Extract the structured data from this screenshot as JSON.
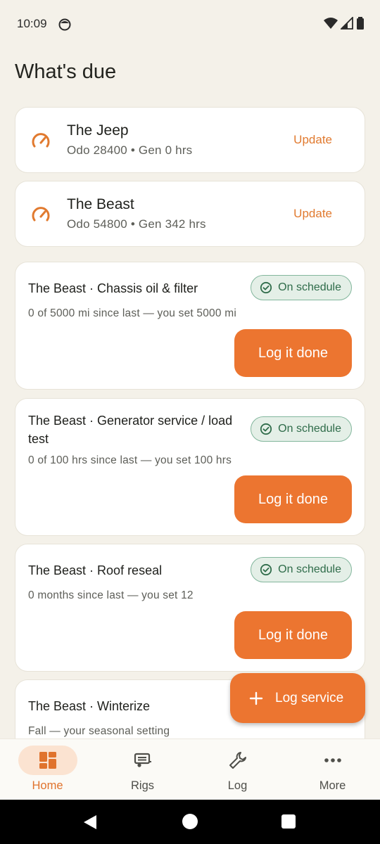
{
  "status_bar": {
    "time": "10:09"
  },
  "page": {
    "title": "What's due"
  },
  "rigs": [
    {
      "name": "The Jeep",
      "meta": "Odo 28400 • Gen 0 hrs",
      "action": "Update",
      "icon": "gauge-icon"
    },
    {
      "name": "The Beast",
      "meta": "Odo 54800 • Gen 342 hrs",
      "action": "Update",
      "icon": "gauge-icon"
    }
  ],
  "tasks": [
    {
      "title": "The Beast · Chassis oil & filter",
      "desc": "0 of 5000 mi since last — you set 5000 mi",
      "status": "On schedule",
      "action": "Log it done"
    },
    {
      "title": "The Beast · Generator service / load test",
      "desc": "0 of 100 hrs since last — you set 100 hrs",
      "status": "On schedule",
      "action": "Log it done"
    },
    {
      "title": "The Beast · Roof reseal",
      "desc": "0 months since last — you set 12",
      "status": "On schedule",
      "action": "Log it done"
    },
    {
      "title": "The Beast · Winterize",
      "desc": "Fall — your seasonal setting"
    }
  ],
  "fab": {
    "label": "Log service",
    "icon": "plus-icon"
  },
  "bottom_nav": [
    {
      "label": "Home",
      "icon": "dashboard-icon",
      "active": true
    },
    {
      "label": "Rigs",
      "icon": "rv-icon",
      "active": false
    },
    {
      "label": "Log",
      "icon": "wrench-icon",
      "active": false
    },
    {
      "label": "More",
      "icon": "more-dots-icon",
      "active": false
    }
  ],
  "colors": {
    "accent": "#ec7530",
    "success": "#2f6c4a",
    "background": "#f4f1e9"
  }
}
